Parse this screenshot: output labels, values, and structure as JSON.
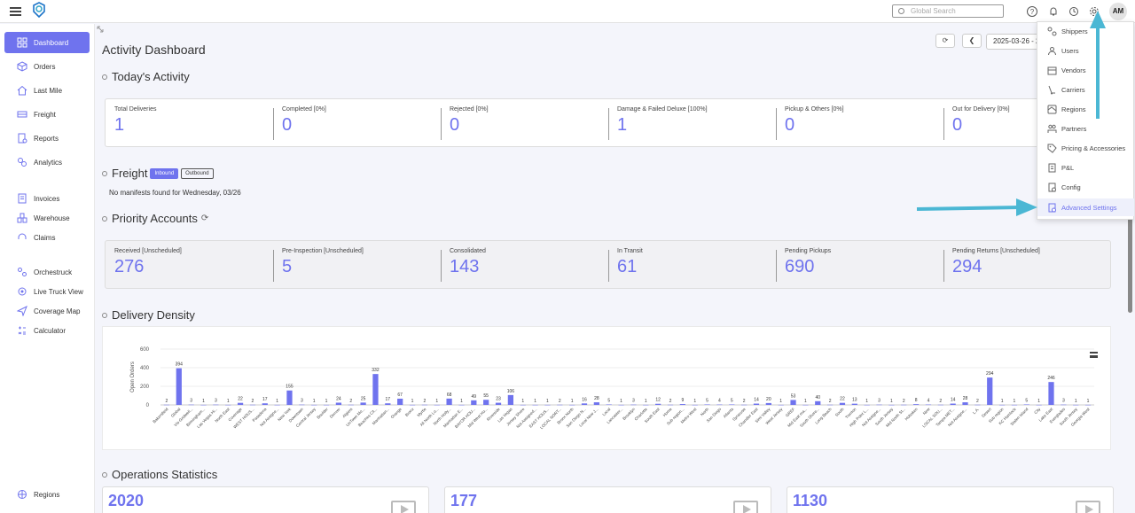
{
  "topbar": {
    "search_placeholder": "Global Search",
    "avatar_initials": "AM",
    "icons": [
      "help-icon",
      "bell-icon",
      "history-icon",
      "gear-icon"
    ]
  },
  "sidebar": {
    "items": [
      {
        "label": "Dashboard",
        "icon": "dashboard-icon",
        "active": true
      },
      {
        "label": "Orders",
        "icon": "box-icon"
      },
      {
        "label": "Last Mile",
        "icon": "house-icon"
      },
      {
        "label": "Freight",
        "icon": "truck-icon"
      },
      {
        "label": "Reports",
        "icon": "report-icon"
      },
      {
        "label": "Analytics",
        "icon": "analytics-icon"
      },
      {
        "label": "Invoices",
        "icon": "invoice-icon"
      },
      {
        "label": "Warehouse",
        "icon": "warehouse-icon"
      },
      {
        "label": "Claims",
        "icon": "headset-icon"
      },
      {
        "label": "Orchestruck",
        "icon": "orchestruck-icon"
      },
      {
        "label": "Live Truck View",
        "icon": "target-icon"
      },
      {
        "label": "Coverage Map",
        "icon": "send-icon"
      },
      {
        "label": "Calculator",
        "icon": "calculator-icon"
      },
      {
        "label": "Regions",
        "icon": "globe-icon"
      }
    ]
  },
  "main": {
    "title": "Activity Dashboard",
    "date_range": "2025-03-26 - 2",
    "todays_activity": {
      "title": "Today's Activity",
      "stats": [
        {
          "label": "Total Deliveries",
          "value": "1"
        },
        {
          "label": "Completed [0%]",
          "value": "0"
        },
        {
          "label": "Rejected [0%]",
          "value": "0"
        },
        {
          "label": "Damage & Failed Deluxe [100%]",
          "value": "1"
        },
        {
          "label": "Pickup & Others [0%]",
          "value": "0"
        },
        {
          "label": "Out for Delivery [0%]",
          "value": "0"
        }
      ]
    },
    "freight": {
      "title": "Freight",
      "inbound_label": "Inbound",
      "outbound_label": "Outbound",
      "empty_message": "No manifests found for Wednesday, 03/26"
    },
    "priority_accounts": {
      "title": "Priority Accounts",
      "stats": [
        {
          "label": "Received [Unscheduled]",
          "value": "276"
        },
        {
          "label": "Pre-Inspection [Unscheduled]",
          "value": "5"
        },
        {
          "label": "Consolidated",
          "value": "143"
        },
        {
          "label": "In Transit",
          "value": "61"
        },
        {
          "label": "Pending Pickups",
          "value": "690"
        },
        {
          "label": "Pending Returns [Unscheduled]",
          "value": "294"
        }
      ]
    },
    "delivery_density": {
      "title": "Delivery Density"
    },
    "operations_statistics": {
      "title": "Operations Statistics",
      "values": [
        "2020",
        "177",
        "1130"
      ]
    }
  },
  "settings_menu": {
    "items": [
      {
        "label": "Shippers",
        "icon": "shippers-icon"
      },
      {
        "label": "Users",
        "icon": "users-icon"
      },
      {
        "label": "Vendors",
        "icon": "vendors-icon"
      },
      {
        "label": "Carriers",
        "icon": "carriers-icon"
      },
      {
        "label": "Regions",
        "icon": "regions-icon"
      },
      {
        "label": "Partners",
        "icon": "partners-icon"
      },
      {
        "label": "Pricing & Accessories",
        "icon": "pricing-icon"
      },
      {
        "label": "P&L",
        "icon": "pnl-icon"
      },
      {
        "label": "Config",
        "icon": "config-icon"
      },
      {
        "label": "Advanced Settings",
        "icon": "advanced-settings-icon",
        "highlighted": true
      }
    ]
  },
  "colors": {
    "accent": "#6f73ee",
    "annotation_arrow": "#4bb7d4"
  },
  "chart_data": {
    "type": "bar",
    "ylabel": "Open Orders",
    "ylim": [
      0,
      600
    ],
    "yticks": [
      0,
      200,
      400,
      600
    ],
    "categories": [
      "Bakersfield",
      "Global",
      "Vis-Gridwell...",
      "Birmingham...",
      "Las Vegas Hi...",
      "North East",
      "Coverage",
      "WEST HOUS...",
      "Pasadena",
      "Not Assigne...",
      "New York",
      "Downtown",
      "Central Jersey",
      "Boulder",
      "Denver",
      "Algiers",
      "UnTown Mo...",
      "Beaches Cit...",
      "Manhattan...",
      "Orange",
      "Bronx",
      "Myrtle",
      "All North Lo...",
      "North Holly...",
      "Manhattan E...",
      "BAYOR HOU...",
      "Mid West Ho...",
      "Riverside",
      "Las Vegas",
      "Jersey Shore",
      "Not Assigned...",
      "EAST HOUS...",
      "LOCAL NORT...",
      "Bronx North",
      "San Diego N...",
      "Local New J...",
      "Local",
      "Lancaster...",
      "Brooklyn",
      "Charlotte",
      "South East",
      "Home",
      "Sub region...",
      "Metro West",
      "North",
      "San Diego",
      "Atlanta",
      "Syracuse",
      "Chandler East",
      "Simi Valley",
      "West Jersey",
      "GREF",
      "Mid East ma...",
      "South Shore...",
      "Long Beach",
      "South",
      "Trenton",
      "High Point L...",
      "Not Assigne...",
      "South Jersey",
      "Mid North St...",
      "Hoboken",
      "New",
      "LOCAL SOU...",
      "Tampa MET...",
      "Not Assigne...",
      "L.A.",
      "Desert",
      "Sub region",
      "KC Hamlock",
      "Staten Island",
      "City",
      "Lake East",
      "Everglades",
      "South Jersey",
      "Georgia West",
      "Not Assigne..."
    ],
    "values": [
      2,
      394,
      3,
      1,
      3,
      1,
      22,
      2,
      17,
      1,
      155,
      3,
      1,
      1,
      24,
      2,
      25,
      332,
      17,
      67,
      1,
      2,
      1,
      68,
      1,
      49,
      55,
      23,
      106,
      1,
      1,
      1,
      2,
      1,
      16,
      28,
      5,
      1,
      3,
      1,
      12,
      2,
      9,
      1,
      5,
      4,
      5,
      2,
      14,
      20,
      1,
      53,
      1,
      40,
      2,
      22,
      13,
      1,
      3,
      1,
      2,
      8,
      4,
      2,
      14,
      28,
      2,
      294,
      1,
      1,
      5,
      1,
      246,
      3,
      1,
      1
    ]
  }
}
